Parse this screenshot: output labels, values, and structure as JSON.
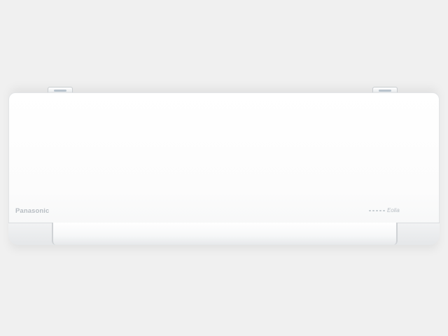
{
  "product": {
    "brand_logo": "Panasonic",
    "model_mark": "Eolia",
    "colors": {
      "background": "#f0f0f0",
      "body": "#ffffff",
      "accent_gray": "#b7bdc3"
    }
  }
}
